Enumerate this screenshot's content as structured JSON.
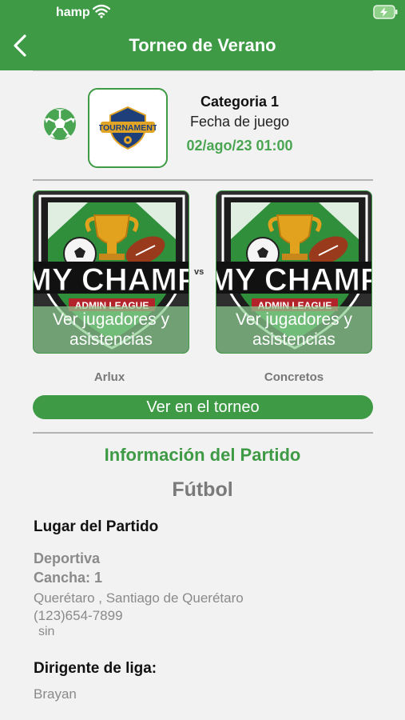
{
  "status_bar": {
    "time": "hamp"
  },
  "header": {
    "title": "Torneo de Verano"
  },
  "match": {
    "categoria": "Categoria 1",
    "fecha_label": "Fecha de juego",
    "fecha_valor": "02/ago/23  01:00",
    "logo_text": "TOURNAMENT",
    "vs": "vs"
  },
  "teams": [
    {
      "name": "Arlux",
      "logo_line1": "MY CHAMP",
      "logo_line2": "ADMIN LEAGUE",
      "overlay": "Ver jugadores y asistencias"
    },
    {
      "name": "Concretos",
      "logo_line1": "MY CHAMP",
      "logo_line2": "ADMIN LEAGUE",
      "overlay": "Ver jugadores y asistencias"
    }
  ],
  "torneo_button": "Ver en el torneo",
  "info": {
    "title": "Información del Partido",
    "sport": "Fútbol",
    "lugar_label": "Lugar del Partido",
    "lugar_nombre": "Deportiva",
    "cancha": "Cancha: 1",
    "direccion": "Querétaro , Santiago de Querétaro",
    "telefono": "(123)654-7899",
    "extra": "sin",
    "dirigente_label": "Dirigente de liga:",
    "dirigente_nombre": "Brayan"
  },
  "colors": {
    "primary": "#3f9a46",
    "accent": "#4aa552",
    "muted": "#8a8a8a"
  }
}
